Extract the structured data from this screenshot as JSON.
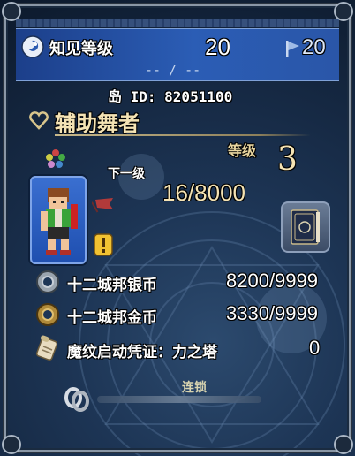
{
  "header": {
    "title": "知见等级",
    "level": "20",
    "flag_level": "20",
    "progress": "-- / --"
  },
  "player": {
    "island_id": "岛 ID: 82051100"
  },
  "job": {
    "name": "辅助舞者",
    "level_label": "等级",
    "level": "3",
    "next_label": "下一级",
    "exp": "16/8000"
  },
  "items": [
    {
      "name": "十二城邦银币",
      "count": "8200/9999",
      "icon": "silver-coin-icon"
    },
    {
      "name": "十二城邦金币",
      "count": "3330/9999",
      "icon": "gold-coin-icon"
    },
    {
      "name": "魔纹启动凭证：力之塔",
      "count": "0",
      "icon": "scroll-icon"
    }
  ],
  "chain": {
    "label": "连锁"
  },
  "colors": {
    "header_blue": "#2b5db5",
    "gold_text": "#e8d6a0",
    "alert_yellow": "#f1c232"
  }
}
